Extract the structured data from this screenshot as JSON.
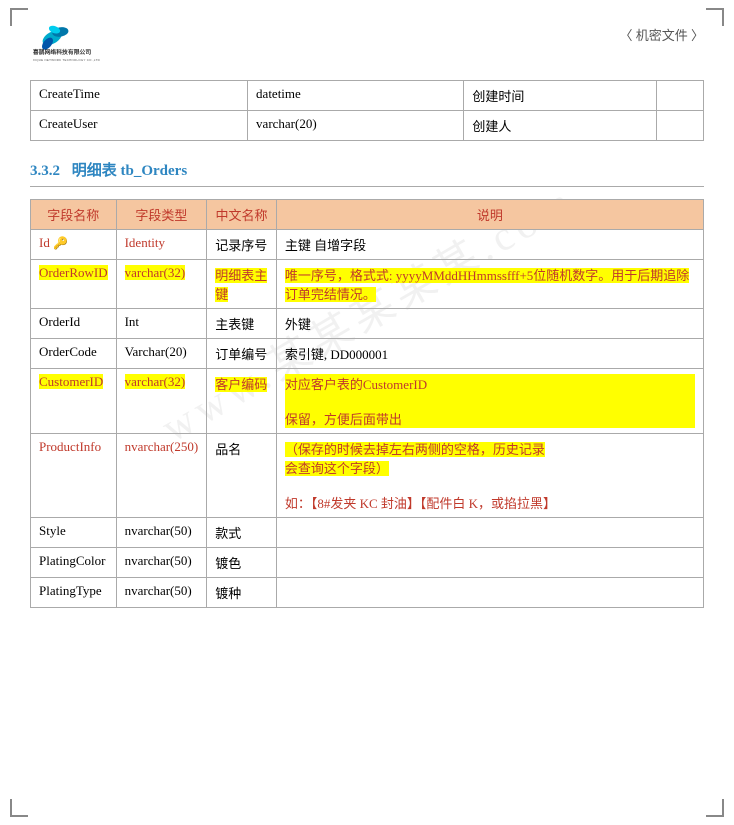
{
  "header": {
    "confidential": "〈 机密文件 〉"
  },
  "top_table": {
    "headers": [],
    "rows": [
      {
        "field": "CreateTime",
        "type": "datetime",
        "cn_name": "创建时间",
        "note": ""
      },
      {
        "field": "CreateUser",
        "type": "varchar(20)",
        "cn_name": "创建人",
        "note": ""
      }
    ]
  },
  "section": {
    "number": "3.3.2",
    "label": "明细表 tb_Orders"
  },
  "table": {
    "col_headers": [
      "字段名称",
      "字段类型",
      "中文名称",
      "说明"
    ],
    "rows": [
      {
        "field": "Id 🔑",
        "type": "Identity",
        "cn_name": "记录序号",
        "note": "主键 自增字段",
        "highlight_field": false,
        "highlight_type": false,
        "note_highlight": false,
        "field_red": true
      },
      {
        "field": "OrderRowID",
        "type": "varchar(32)",
        "cn_name": "明细表主键",
        "note": "唯一序号，格式式: yyyyMMddHHmmssfff+5位随机数字。用于后期追除订单完结情况。",
        "highlight_field": true,
        "highlight_type": true,
        "cn_highlight": true,
        "note_highlight": true,
        "field_red": true
      },
      {
        "field": "OrderId",
        "type": "Int",
        "cn_name": "主表键",
        "note": "外键",
        "highlight_field": false,
        "highlight_type": false,
        "note_highlight": false,
        "field_red": false
      },
      {
        "field": "OrderCode",
        "type": "Varchar(20)",
        "cn_name": "订单编号",
        "note": "索引键, DD000001",
        "highlight_field": false,
        "highlight_type": false,
        "note_highlight": false,
        "field_red": false
      },
      {
        "field": "CustomerID",
        "type": "varchar(32)",
        "cn_name": "客户编码",
        "note_lines": [
          "对应客户表的CustomerID",
          "",
          "保留，方便后面带出"
        ],
        "highlight_field": true,
        "highlight_type": true,
        "cn_highlight": true,
        "note_highlight": true,
        "field_red": true
      },
      {
        "field": "ProductInfo",
        "type": "nvarchar(250)",
        "cn_name": "品名",
        "note_lines": [
          "（保存的时候去掉左右两侧的空格，历史记录会查询这个字段）",
          "",
          "如：【8#发夹 KC 封油】【配件白 K，或掐拉黑】"
        ],
        "highlight_field": false,
        "highlight_type": false,
        "note_highlight": true,
        "field_red": true
      },
      {
        "field": "Style",
        "type": "nvarchar(50)",
        "cn_name": "款式",
        "note": "",
        "highlight_field": false,
        "highlight_type": false,
        "note_highlight": false,
        "field_red": false
      },
      {
        "field": "PlatingColor",
        "type": "nvarchar(50)",
        "cn_name": "镀色",
        "note": "",
        "highlight_field": false,
        "highlight_type": false,
        "note_highlight": false,
        "field_red": false
      },
      {
        "field": "PlatingType",
        "type": "nvarchar(50)",
        "cn_name": "镀种",
        "note": "",
        "highlight_field": false,
        "highlight_type": false,
        "note_highlight": false,
        "field_red": false
      }
    ]
  },
  "watermark_text": "www.某某某某某.com"
}
